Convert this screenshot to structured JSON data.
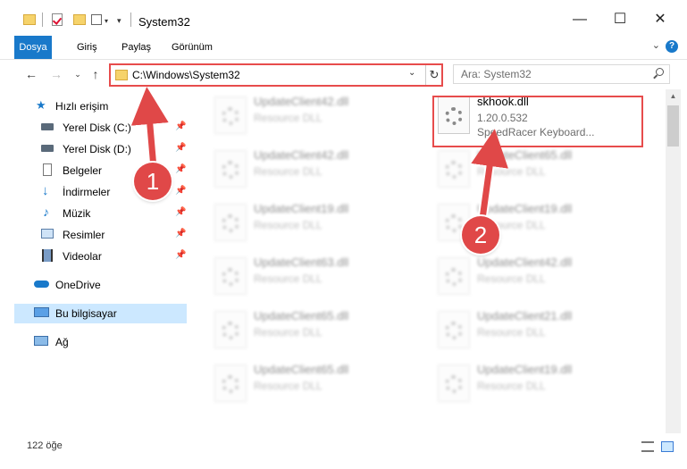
{
  "window": {
    "title": "System32",
    "minimize_icon": "minimize-icon",
    "maximize_icon": "maximize-icon",
    "close_icon": "close-icon"
  },
  "ribbon": {
    "tabs": [
      "Dosya",
      "Giriş",
      "Paylaş",
      "Görünüm"
    ],
    "active_color": "#1979ca"
  },
  "nav": {
    "address": "C:\\Windows\\System32",
    "search_placeholder": "Ara: System32"
  },
  "sidebar": {
    "items": [
      {
        "label": "Hızlı erişim",
        "icon": "star-icon",
        "pinned": false
      },
      {
        "label": "Yerel Disk (C:)",
        "icon": "drive-icon",
        "pinned": true
      },
      {
        "label": "Yerel Disk (D:)",
        "icon": "drive-icon",
        "pinned": true
      },
      {
        "label": "Belgeler",
        "icon": "document-icon",
        "pinned": true
      },
      {
        "label": "İndirmeler",
        "icon": "download-icon",
        "pinned": true
      },
      {
        "label": "Müzik",
        "icon": "music-icon",
        "pinned": true
      },
      {
        "label": "Resimler",
        "icon": "pictures-icon",
        "pinned": true
      },
      {
        "label": "Videolar",
        "icon": "video-icon",
        "pinned": true
      },
      {
        "label": "OneDrive",
        "icon": "cloud-icon",
        "pinned": false
      },
      {
        "label": "Bu bilgisayar",
        "icon": "computer-icon",
        "pinned": false,
        "selected": true
      },
      {
        "label": "Ağ",
        "icon": "network-icon",
        "pinned": false
      }
    ]
  },
  "files": {
    "left": [
      {
        "name": "UpdateClient42.dll",
        "type": "Resource DLL"
      },
      {
        "name": "UpdateClient42.dll",
        "type": "Resource DLL"
      },
      {
        "name": "UpdateClient19.dll",
        "type": "Resource DLL"
      },
      {
        "name": "UpdateClient63.dll",
        "type": "Resource DLL"
      },
      {
        "name": "UpdateClient65.dll",
        "type": "Resource DLL"
      },
      {
        "name": "UpdateClient65.dll",
        "type": "Resource DLL"
      }
    ],
    "right": [
      {
        "name": "skhook.dll",
        "version": "1.20.0.532",
        "description": "SpeedRacer Keyboard..."
      },
      {
        "name": "UpdateClient65.dll",
        "type": "Resource DLL"
      },
      {
        "name": "UpdateClient19.dll",
        "type": "Resource DLL"
      },
      {
        "name": "UpdateClient42.dll",
        "type": "Resource DLL"
      },
      {
        "name": "UpdateClient21.dll",
        "type": "Resource DLL"
      },
      {
        "name": "UpdateClient19.dll",
        "type": "Resource DLL"
      }
    ]
  },
  "status": {
    "count": "122 öğe"
  },
  "annotations": {
    "callout1": "1",
    "callout2": "2",
    "color": "#e04848"
  }
}
